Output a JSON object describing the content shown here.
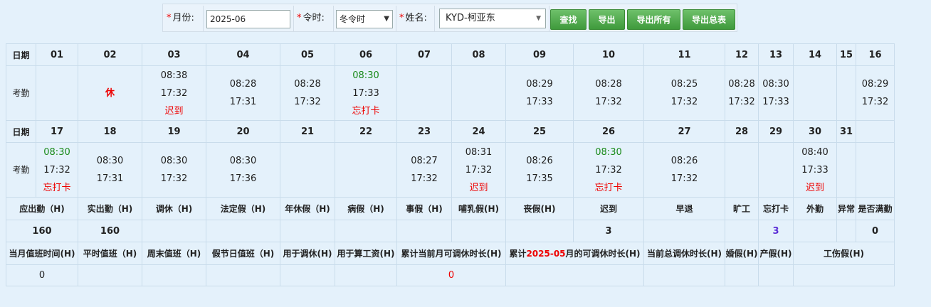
{
  "filter": {
    "month_label": "月份:",
    "month_value": "2025-06",
    "season_label": "令时:",
    "season_value": "冬令时",
    "name_label": "姓名:",
    "name_value": "KYD-柯亚东",
    "required_mark": "*",
    "buttons": {
      "search": "查找",
      "export": "导出",
      "export_all": "导出所有",
      "export_summary": "导出总表"
    }
  },
  "labels": {
    "date": "日期",
    "attendance": "考勤"
  },
  "week1": {
    "days": [
      "01",
      "02",
      "03",
      "04",
      "05",
      "06",
      "07",
      "08",
      "09",
      "10",
      "11",
      "12",
      "13",
      "14",
      "15",
      "16"
    ],
    "cells": [
      {
        "lines": []
      },
      {
        "lines": [
          {
            "t": "休",
            "c": "rest"
          }
        ]
      },
      {
        "lines": [
          {
            "t": "08:38",
            "c": ""
          },
          {
            "t": "17:32",
            "c": ""
          },
          {
            "t": "迟到",
            "c": "red"
          }
        ]
      },
      {
        "lines": [
          {
            "t": "08:28",
            "c": ""
          },
          {
            "t": "17:31",
            "c": ""
          }
        ]
      },
      {
        "lines": [
          {
            "t": "08:28",
            "c": ""
          },
          {
            "t": "17:32",
            "c": ""
          }
        ]
      },
      {
        "lines": [
          {
            "t": "08:30",
            "c": "green"
          },
          {
            "t": "17:33",
            "c": ""
          },
          {
            "t": "忘打卡",
            "c": "red"
          }
        ]
      },
      {
        "lines": []
      },
      {
        "lines": []
      },
      {
        "lines": [
          {
            "t": "08:29",
            "c": ""
          },
          {
            "t": "17:33",
            "c": ""
          }
        ]
      },
      {
        "lines": [
          {
            "t": "08:28",
            "c": ""
          },
          {
            "t": "17:32",
            "c": ""
          }
        ]
      },
      {
        "lines": [
          {
            "t": "08:25",
            "c": ""
          },
          {
            "t": "17:32",
            "c": ""
          }
        ]
      },
      {
        "lines": [
          {
            "t": "08:28",
            "c": ""
          },
          {
            "t": "17:32",
            "c": ""
          }
        ]
      },
      {
        "lines": [
          {
            "t": "08:30",
            "c": ""
          },
          {
            "t": "17:33",
            "c": ""
          }
        ]
      },
      {
        "lines": []
      },
      {
        "lines": []
      },
      {
        "lines": [
          {
            "t": "08:29",
            "c": ""
          },
          {
            "t": "17:32",
            "c": ""
          }
        ]
      }
    ]
  },
  "week2": {
    "days": [
      "17",
      "18",
      "19",
      "20",
      "21",
      "22",
      "23",
      "24",
      "25",
      "26",
      "27",
      "28",
      "29",
      "30",
      "31",
      ""
    ],
    "cells": [
      {
        "lines": [
          {
            "t": "08:30",
            "c": "green"
          },
          {
            "t": "17:32",
            "c": ""
          },
          {
            "t": "忘打卡",
            "c": "red"
          }
        ]
      },
      {
        "lines": [
          {
            "t": "08:30",
            "c": ""
          },
          {
            "t": "17:31",
            "c": ""
          }
        ]
      },
      {
        "lines": [
          {
            "t": "08:30",
            "c": ""
          },
          {
            "t": "17:32",
            "c": ""
          }
        ]
      },
      {
        "lines": [
          {
            "t": "08:30",
            "c": ""
          },
          {
            "t": "17:36",
            "c": ""
          }
        ]
      },
      {
        "lines": []
      },
      {
        "lines": []
      },
      {
        "lines": [
          {
            "t": "08:27",
            "c": ""
          },
          {
            "t": "17:32",
            "c": ""
          }
        ]
      },
      {
        "lines": [
          {
            "t": "08:31",
            "c": ""
          },
          {
            "t": "17:32",
            "c": ""
          },
          {
            "t": "迟到",
            "c": "red"
          }
        ]
      },
      {
        "lines": [
          {
            "t": "08:26",
            "c": ""
          },
          {
            "t": "17:35",
            "c": ""
          }
        ]
      },
      {
        "lines": [
          {
            "t": "08:30",
            "c": "green"
          },
          {
            "t": "17:32",
            "c": ""
          },
          {
            "t": "忘打卡",
            "c": "red"
          }
        ]
      },
      {
        "lines": [
          {
            "t": "08:26",
            "c": ""
          },
          {
            "t": "17:32",
            "c": ""
          }
        ]
      },
      {
        "lines": []
      },
      {
        "lines": []
      },
      {
        "lines": [
          {
            "t": "08:40",
            "c": ""
          },
          {
            "t": "17:33",
            "c": ""
          },
          {
            "t": "迟到",
            "c": "red"
          }
        ]
      },
      {
        "lines": []
      },
      {
        "lines": []
      }
    ]
  },
  "summary1": {
    "headers": [
      "应出勤（H)",
      "实出勤（H)",
      "调休（H)",
      "法定假（H)",
      "年休假（H)",
      "病假（H)",
      "事假（H)",
      "哺乳假(H)",
      "丧假(H)",
      "迟到",
      "早退",
      "旷工",
      "忘打卡",
      "外勤",
      "异常",
      "是否满勤"
    ],
    "values": [
      {
        "t": "160",
        "c": ""
      },
      {
        "t": "160",
        "c": ""
      },
      {
        "t": "",
        "c": ""
      },
      {
        "t": "",
        "c": ""
      },
      {
        "t": "",
        "c": ""
      },
      {
        "t": "",
        "c": ""
      },
      {
        "t": "",
        "c": ""
      },
      {
        "t": "",
        "c": ""
      },
      {
        "t": "",
        "c": ""
      },
      {
        "t": "3",
        "c": ""
      },
      {
        "t": "",
        "c": ""
      },
      {
        "t": "",
        "c": ""
      },
      {
        "t": "3",
        "c": "purple"
      },
      {
        "t": "",
        "c": ""
      },
      {
        "t": "",
        "c": ""
      },
      {
        "t": "0",
        "c": ""
      }
    ]
  },
  "summary2": {
    "headers": [
      "当月值班时间(H)",
      "平时值班（H)",
      "周末值班（H)",
      "假节日值班（H)",
      "用于调休(H)",
      "用于算工资(H)",
      "累计当前月可调休时长(H)",
      "累计2025-05月的可调休时长(H)",
      "当前总调休时长(H)",
      "婚假(H)",
      "产假(H)",
      "工伤假(H)"
    ],
    "carry_prefix": "累计",
    "carry_month": "2025-05",
    "carry_suffix": "月的可调休时长(H)",
    "values": [
      {
        "t": "0",
        "c": ""
      },
      {
        "t": "",
        "c": ""
      },
      {
        "t": "",
        "c": ""
      },
      {
        "t": "",
        "c": ""
      },
      {
        "t": "",
        "c": ""
      },
      {
        "t": "",
        "c": ""
      },
      {
        "t": "0",
        "c": "red"
      },
      {
        "t": "",
        "c": ""
      },
      {
        "t": "",
        "c": ""
      },
      {
        "t": "",
        "c": ""
      },
      {
        "t": "",
        "c": ""
      },
      {
        "t": "",
        "c": ""
      }
    ]
  },
  "colors": {
    "late": "#e00000",
    "normal_green": "#1a8a1a",
    "button": "#4caa48",
    "highlight_purple": "#5b2dd6"
  }
}
